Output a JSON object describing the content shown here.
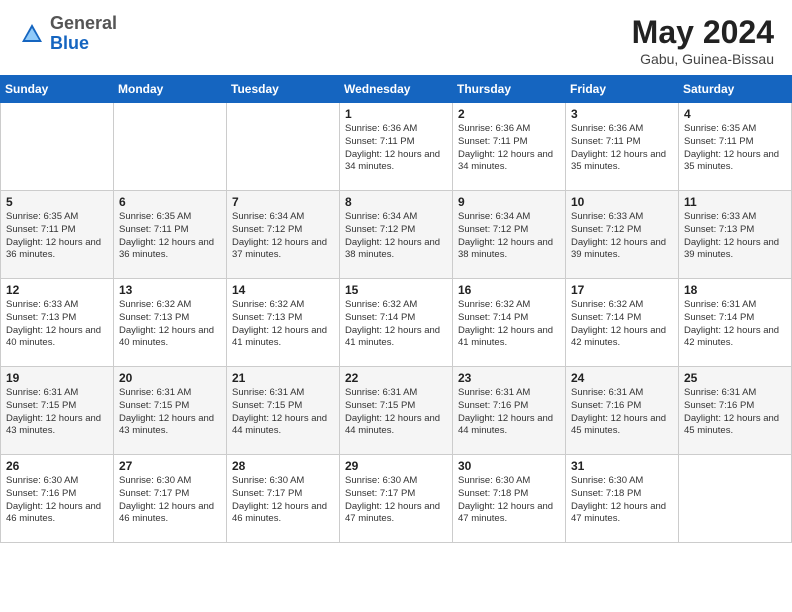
{
  "header": {
    "logo_general": "General",
    "logo_blue": "Blue",
    "title": "May 2024",
    "subtitle": "Gabu, Guinea-Bissau"
  },
  "days_of_week": [
    "Sunday",
    "Monday",
    "Tuesday",
    "Wednesday",
    "Thursday",
    "Friday",
    "Saturday"
  ],
  "weeks": [
    [
      {
        "day": "",
        "info": ""
      },
      {
        "day": "",
        "info": ""
      },
      {
        "day": "",
        "info": ""
      },
      {
        "day": "1",
        "info": "Sunrise: 6:36 AM\nSunset: 7:11 PM\nDaylight: 12 hours and 34 minutes."
      },
      {
        "day": "2",
        "info": "Sunrise: 6:36 AM\nSunset: 7:11 PM\nDaylight: 12 hours and 34 minutes."
      },
      {
        "day": "3",
        "info": "Sunrise: 6:36 AM\nSunset: 7:11 PM\nDaylight: 12 hours and 35 minutes."
      },
      {
        "day": "4",
        "info": "Sunrise: 6:35 AM\nSunset: 7:11 PM\nDaylight: 12 hours and 35 minutes."
      }
    ],
    [
      {
        "day": "5",
        "info": "Sunrise: 6:35 AM\nSunset: 7:11 PM\nDaylight: 12 hours and 36 minutes."
      },
      {
        "day": "6",
        "info": "Sunrise: 6:35 AM\nSunset: 7:11 PM\nDaylight: 12 hours and 36 minutes."
      },
      {
        "day": "7",
        "info": "Sunrise: 6:34 AM\nSunset: 7:12 PM\nDaylight: 12 hours and 37 minutes."
      },
      {
        "day": "8",
        "info": "Sunrise: 6:34 AM\nSunset: 7:12 PM\nDaylight: 12 hours and 38 minutes."
      },
      {
        "day": "9",
        "info": "Sunrise: 6:34 AM\nSunset: 7:12 PM\nDaylight: 12 hours and 38 minutes."
      },
      {
        "day": "10",
        "info": "Sunrise: 6:33 AM\nSunset: 7:12 PM\nDaylight: 12 hours and 39 minutes."
      },
      {
        "day": "11",
        "info": "Sunrise: 6:33 AM\nSunset: 7:13 PM\nDaylight: 12 hours and 39 minutes."
      }
    ],
    [
      {
        "day": "12",
        "info": "Sunrise: 6:33 AM\nSunset: 7:13 PM\nDaylight: 12 hours and 40 minutes."
      },
      {
        "day": "13",
        "info": "Sunrise: 6:32 AM\nSunset: 7:13 PM\nDaylight: 12 hours and 40 minutes."
      },
      {
        "day": "14",
        "info": "Sunrise: 6:32 AM\nSunset: 7:13 PM\nDaylight: 12 hours and 41 minutes."
      },
      {
        "day": "15",
        "info": "Sunrise: 6:32 AM\nSunset: 7:14 PM\nDaylight: 12 hours and 41 minutes."
      },
      {
        "day": "16",
        "info": "Sunrise: 6:32 AM\nSunset: 7:14 PM\nDaylight: 12 hours and 41 minutes."
      },
      {
        "day": "17",
        "info": "Sunrise: 6:32 AM\nSunset: 7:14 PM\nDaylight: 12 hours and 42 minutes."
      },
      {
        "day": "18",
        "info": "Sunrise: 6:31 AM\nSunset: 7:14 PM\nDaylight: 12 hours and 42 minutes."
      }
    ],
    [
      {
        "day": "19",
        "info": "Sunrise: 6:31 AM\nSunset: 7:15 PM\nDaylight: 12 hours and 43 minutes."
      },
      {
        "day": "20",
        "info": "Sunrise: 6:31 AM\nSunset: 7:15 PM\nDaylight: 12 hours and 43 minutes."
      },
      {
        "day": "21",
        "info": "Sunrise: 6:31 AM\nSunset: 7:15 PM\nDaylight: 12 hours and 44 minutes."
      },
      {
        "day": "22",
        "info": "Sunrise: 6:31 AM\nSunset: 7:15 PM\nDaylight: 12 hours and 44 minutes."
      },
      {
        "day": "23",
        "info": "Sunrise: 6:31 AM\nSunset: 7:16 PM\nDaylight: 12 hours and 44 minutes."
      },
      {
        "day": "24",
        "info": "Sunrise: 6:31 AM\nSunset: 7:16 PM\nDaylight: 12 hours and 45 minutes."
      },
      {
        "day": "25",
        "info": "Sunrise: 6:31 AM\nSunset: 7:16 PM\nDaylight: 12 hours and 45 minutes."
      }
    ],
    [
      {
        "day": "26",
        "info": "Sunrise: 6:30 AM\nSunset: 7:16 PM\nDaylight: 12 hours and 46 minutes."
      },
      {
        "day": "27",
        "info": "Sunrise: 6:30 AM\nSunset: 7:17 PM\nDaylight: 12 hours and 46 minutes."
      },
      {
        "day": "28",
        "info": "Sunrise: 6:30 AM\nSunset: 7:17 PM\nDaylight: 12 hours and 46 minutes."
      },
      {
        "day": "29",
        "info": "Sunrise: 6:30 AM\nSunset: 7:17 PM\nDaylight: 12 hours and 47 minutes."
      },
      {
        "day": "30",
        "info": "Sunrise: 6:30 AM\nSunset: 7:18 PM\nDaylight: 12 hours and 47 minutes."
      },
      {
        "day": "31",
        "info": "Sunrise: 6:30 AM\nSunset: 7:18 PM\nDaylight: 12 hours and 47 minutes."
      },
      {
        "day": "",
        "info": ""
      }
    ]
  ]
}
